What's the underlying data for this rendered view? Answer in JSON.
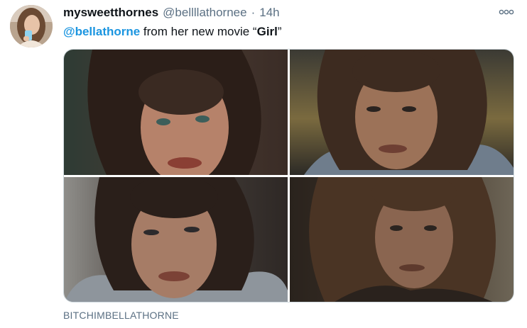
{
  "author": {
    "display_name": "mysweetthornes",
    "handle": "@bellllathornee",
    "separator": "·",
    "time": "14h"
  },
  "tweet": {
    "mention": "@bellathorne",
    "text_middle": " from her new movie “",
    "title": "Girl",
    "text_end": "”"
  },
  "photos": [
    {
      "icon": "photo"
    },
    {
      "icon": "photo"
    },
    {
      "icon": "photo"
    },
    {
      "icon": "photo"
    }
  ],
  "caption": "BITCHIMBELLATHORNE",
  "colors": {
    "link": "#1b95e0",
    "secondary_text": "#5b7083",
    "primary_text": "#0f1419"
  }
}
